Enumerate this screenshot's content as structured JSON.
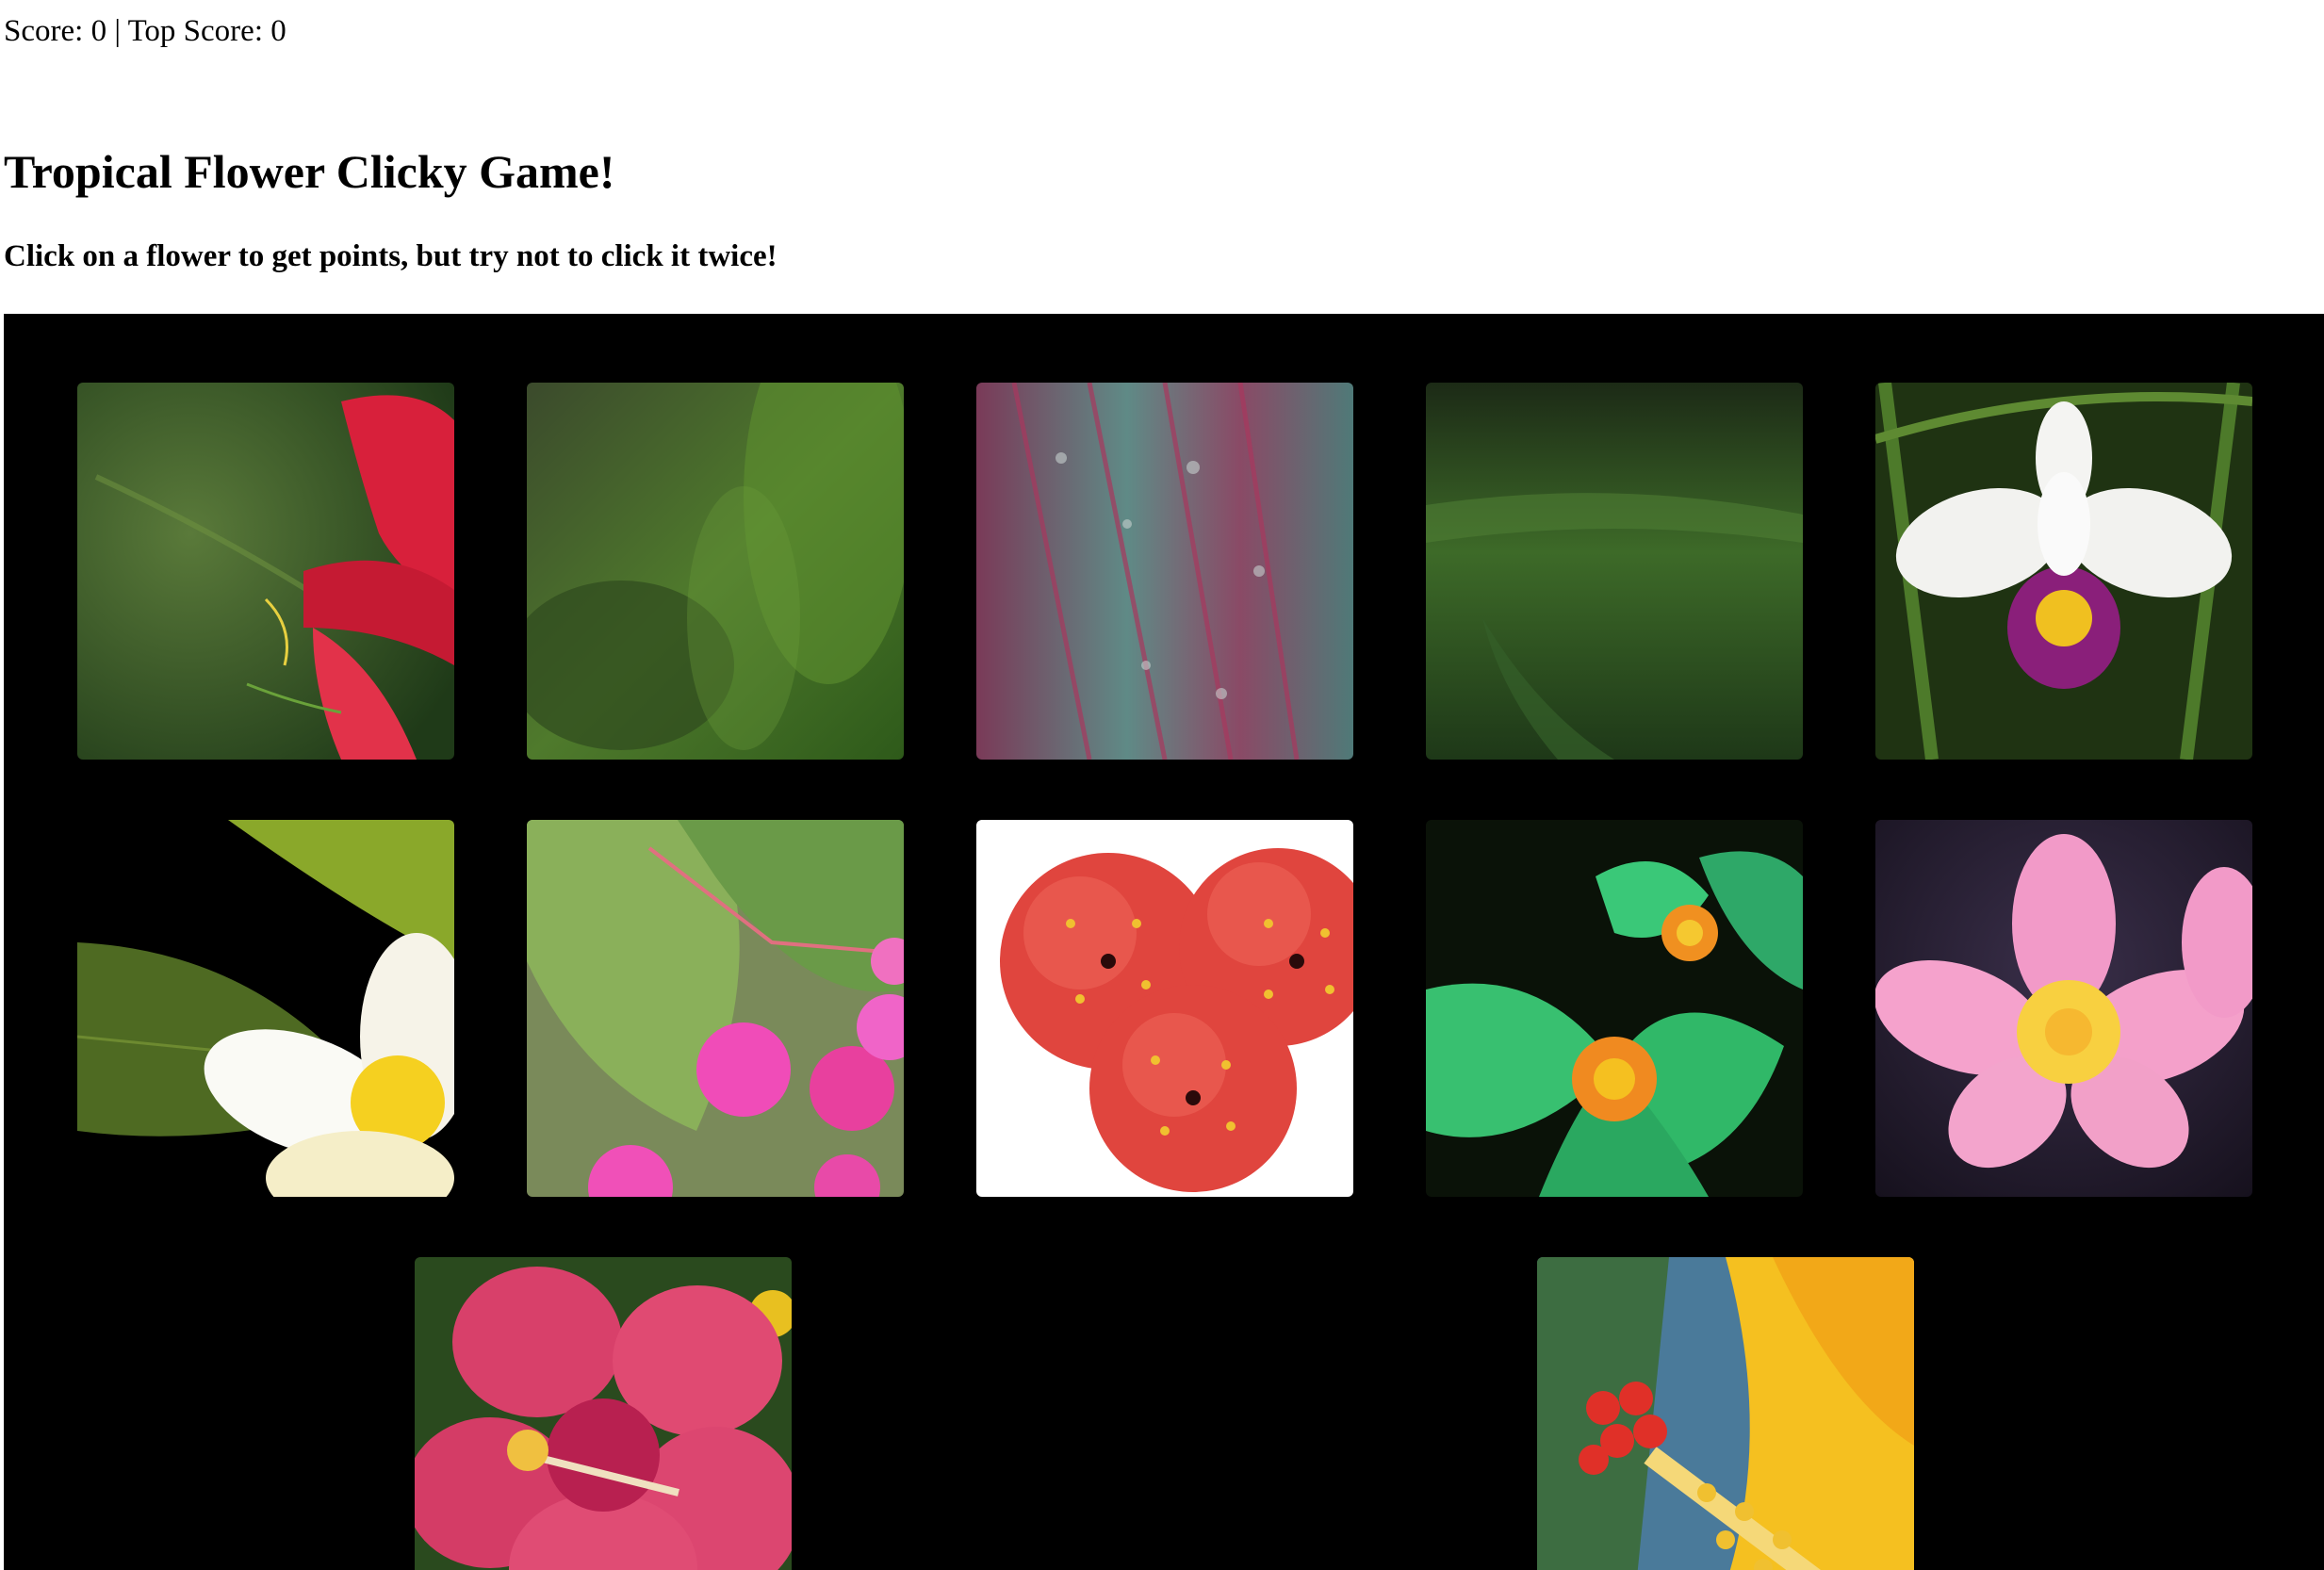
{
  "header": {
    "score_label": "Score:",
    "score": 0,
    "separator": "|",
    "top_score_label": "Top Score:",
    "top_score": 0,
    "title": "Tropical Flower Clicky Game!",
    "instructions": "Click on a flower to get points, but try not to click it twice!"
  },
  "cards": [
    {
      "name": "red-lily-flower-card",
      "subject": "red lily petals on green background"
    },
    {
      "name": "green-leaves-card",
      "subject": "blurred green tropical leaves"
    },
    {
      "name": "ti-leaf-card",
      "subject": "variegated ti leaf with water droplets"
    },
    {
      "name": "green-foliage-card",
      "subject": "dark green blurred foliage"
    },
    {
      "name": "white-orchid-card",
      "subject": "white orchid with purple lip"
    },
    {
      "name": "white-plumeria-card",
      "subject": "white and yellow plumeria with leaves"
    },
    {
      "name": "pink-begonia-card",
      "subject": "pink begonia buds and leaves"
    },
    {
      "name": "red-hibiscus-illustration-card",
      "subject": "three red flowers on white"
    },
    {
      "name": "green-orange-flower-card",
      "subject": "green and orange tropical flowers"
    },
    {
      "name": "pink-plumeria-card",
      "subject": "pink plumeria with water drops"
    },
    {
      "name": "pink-hibiscus-card",
      "subject": "pink hibiscus flower"
    },
    {
      "name": "yellow-hibiscus-card",
      "subject": "yellow hibiscus stamen closeup"
    }
  ],
  "colors": {
    "board": "#000000",
    "page": "#ffffff"
  }
}
